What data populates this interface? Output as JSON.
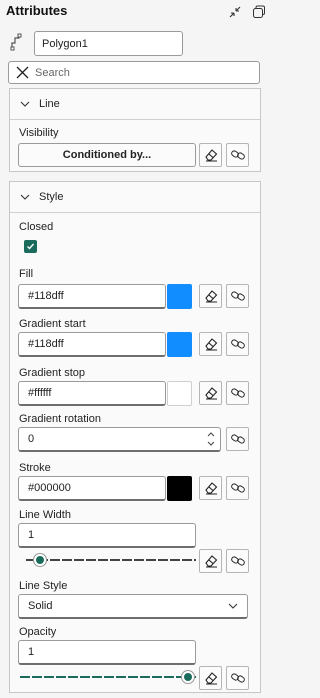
{
  "panel_title": "Attributes",
  "name_value": "Polygon1",
  "search_placeholder": "Search",
  "line_section": {
    "title": "Line",
    "visibility_label": "Visibility",
    "conditioned_button": "Conditioned by..."
  },
  "style_section": {
    "title": "Style",
    "closed_label": "Closed",
    "closed_checked": true,
    "fill_label": "Fill",
    "fill_value": "#118dff",
    "fill_color": "#118dff",
    "gradient_start_label": "Gradient start",
    "gradient_start_value": "#118dff",
    "gradient_start_color": "#118dff",
    "gradient_stop_label": "Gradient stop",
    "gradient_stop_value": "#ffffff",
    "gradient_stop_color": "#ffffff",
    "gradient_rotation_label": "Gradient rotation",
    "gradient_rotation_value": "0",
    "stroke_label": "Stroke",
    "stroke_value": "#000000",
    "stroke_color": "#000000",
    "line_width_label": "Line Width",
    "line_width_value": "1",
    "line_width_slider_fraction": 0.0,
    "line_style_label": "Line Style",
    "line_style_value": "Solid",
    "opacity_label": "Opacity",
    "opacity_value": "1",
    "opacity_slider_fraction": 1.0
  },
  "accent_color": "#1b6b5d"
}
